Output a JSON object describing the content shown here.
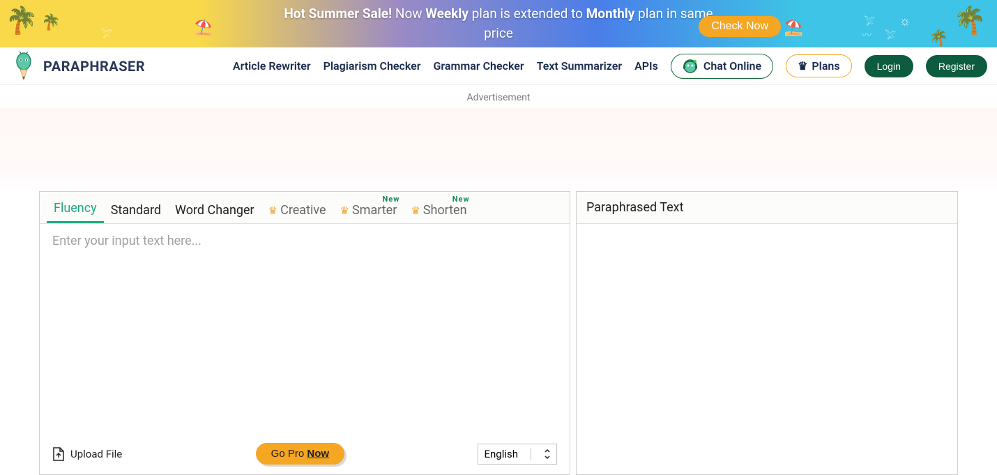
{
  "banner": {
    "line1_prefix": "Hot Summer Sale!",
    "line1_mid1": " Now ",
    "line1_bold1": "Weekly",
    "line1_mid2": " plan is extended to ",
    "line1_bold2": "Monthly",
    "line1_suffix": " plan in same",
    "line2": "price",
    "check_now": "Check Now"
  },
  "brand": {
    "name": "PARAPHRASER"
  },
  "nav": {
    "article_rewriter": "Article Rewriter",
    "plagiarism_checker": "Plagiarism Checker",
    "grammar_checker": "Grammar Checker",
    "text_summarizer": "Text Summarizer",
    "apis": "APIs",
    "chat_online": "Chat Online",
    "plans": "Plans",
    "login": "Login",
    "register": "Register"
  },
  "ad": {
    "label": "Advertisement"
  },
  "tabs": {
    "fluency": "Fluency",
    "standard": "Standard",
    "word_changer": "Word Changer",
    "creative": "Creative",
    "smarter": "Smarter",
    "shorten": "Shorten",
    "new_badge": "New"
  },
  "input": {
    "placeholder": "Enter your input text here...",
    "upload": "Upload File",
    "go_pro_prefix": "Go Pro ",
    "go_pro_now": "Now",
    "language": "English"
  },
  "output": {
    "header": "Paraphrased Text"
  }
}
